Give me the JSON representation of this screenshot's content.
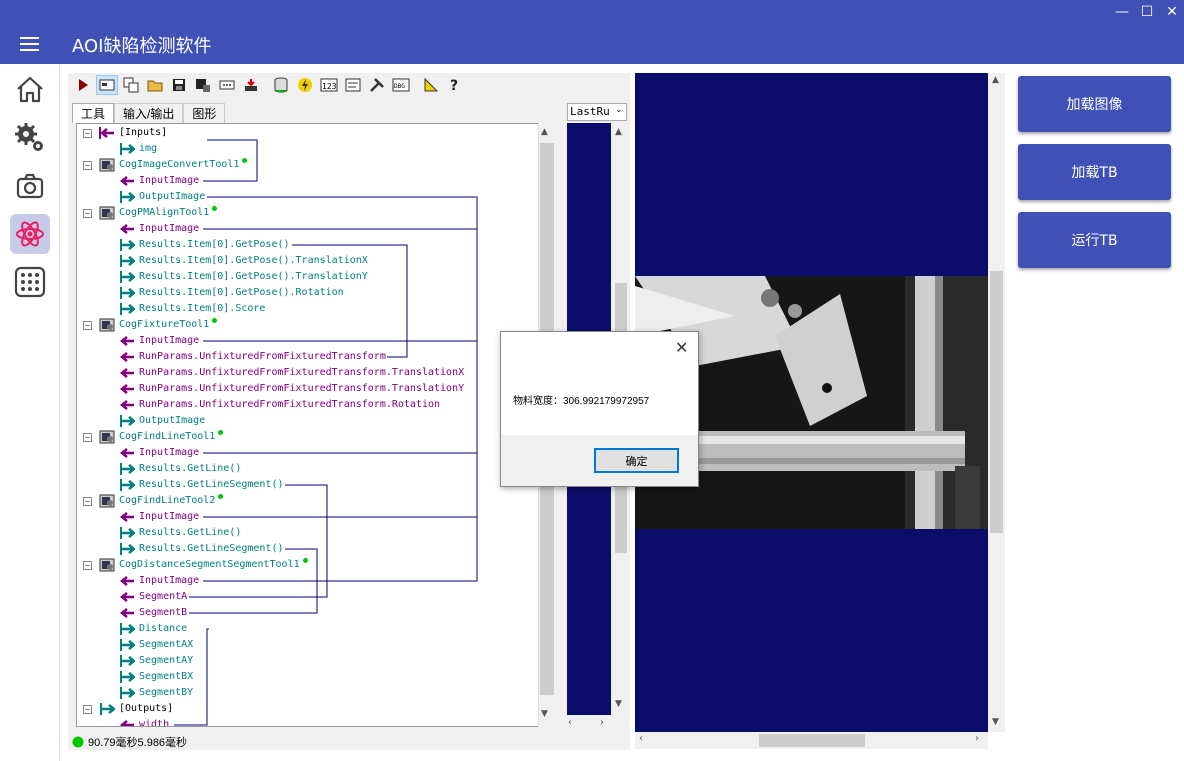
{
  "window": {
    "minimize": "—",
    "maximize": "☐",
    "close": "✕"
  },
  "app": {
    "title": "AOI缺陷检测软件"
  },
  "sidebar": {
    "items": [
      {
        "name": "home-icon"
      },
      {
        "name": "settings-icon"
      },
      {
        "name": "camera-icon"
      },
      {
        "name": "atom-icon",
        "active": true
      },
      {
        "name": "apps-grid-icon"
      }
    ]
  },
  "cog": {
    "tabs": [
      "工具",
      "输入/输出",
      "图形"
    ],
    "lastrun": "LastRu",
    "status": "90.79毫秒5.986毫秒",
    "tree": [
      {
        "text": "[Inputs]",
        "color": "#000000",
        "arrow": "in-root",
        "level": 0
      },
      {
        "text": "img",
        "color": "#008080",
        "arrow": "out",
        "level": 1
      },
      {
        "text": "CogImageConvertTool1",
        "color": "#008080",
        "arrow": "tool",
        "level": 0
      },
      {
        "text": "InputImage",
        "color": "#800080",
        "arrow": "in",
        "level": 1
      },
      {
        "text": "OutputImage",
        "color": "#008080",
        "arrow": "out",
        "level": 1
      },
      {
        "text": "CogPMAlignTool1",
        "color": "#008080",
        "arrow": "tool",
        "level": 0
      },
      {
        "text": "InputImage",
        "color": "#800080",
        "arrow": "in",
        "level": 1
      },
      {
        "text": "Results.Item[0].GetPose()",
        "color": "#008080",
        "arrow": "out",
        "level": 1
      },
      {
        "text": "Results.Item[0].GetPose().TranslationX",
        "color": "#008080",
        "arrow": "out",
        "level": 1
      },
      {
        "text": "Results.Item[0].GetPose().TranslationY",
        "color": "#008080",
        "arrow": "out",
        "level": 1
      },
      {
        "text": "Results.Item[0].GetPose().Rotation",
        "color": "#008080",
        "arrow": "out",
        "level": 1
      },
      {
        "text": "Results.Item[0].Score",
        "color": "#008080",
        "arrow": "out",
        "level": 1
      },
      {
        "text": "CogFixtureTool1",
        "color": "#008080",
        "arrow": "tool",
        "level": 0
      },
      {
        "text": "InputImage",
        "color": "#800080",
        "arrow": "in",
        "level": 1
      },
      {
        "text": "RunParams.UnfixturedFromFixturedTransform",
        "color": "#800080",
        "arrow": "in",
        "level": 1
      },
      {
        "text": "RunParams.UnfixturedFromFixturedTransform.TranslationX",
        "color": "#800080",
        "arrow": "in",
        "level": 1
      },
      {
        "text": "RunParams.UnfixturedFromFixturedTransform.TranslationY",
        "color": "#800080",
        "arrow": "in",
        "level": 1
      },
      {
        "text": "RunParams.UnfixturedFromFixturedTransform.Rotation",
        "color": "#800080",
        "arrow": "in",
        "level": 1
      },
      {
        "text": "OutputImage",
        "color": "#008080",
        "arrow": "out",
        "level": 1
      },
      {
        "text": "CogFindLineTool1",
        "color": "#008080",
        "arrow": "tool",
        "level": 0
      },
      {
        "text": "InputImage",
        "color": "#800080",
        "arrow": "in",
        "level": 1
      },
      {
        "text": "Results.GetLine()",
        "color": "#008080",
        "arrow": "out",
        "level": 1
      },
      {
        "text": "Results.GetLineSegment()",
        "color": "#008080",
        "arrow": "out",
        "level": 1
      },
      {
        "text": "CogFindLineTool2",
        "color": "#008080",
        "arrow": "tool",
        "level": 0
      },
      {
        "text": "InputImage",
        "color": "#800080",
        "arrow": "in",
        "level": 1
      },
      {
        "text": "Results.GetLine()",
        "color": "#008080",
        "arrow": "out",
        "level": 1
      },
      {
        "text": "Results.GetLineSegment()",
        "color": "#008080",
        "arrow": "out",
        "level": 1
      },
      {
        "text": "CogDistanceSegmentSegmentTool1",
        "color": "#008080",
        "arrow": "tool",
        "level": 0
      },
      {
        "text": "InputImage",
        "color": "#800080",
        "arrow": "in",
        "level": 1
      },
      {
        "text": "SegmentA",
        "color": "#800080",
        "arrow": "in",
        "level": 1
      },
      {
        "text": "SegmentB",
        "color": "#800080",
        "arrow": "in",
        "level": 1
      },
      {
        "text": "Distance",
        "color": "#008080",
        "arrow": "out",
        "level": 1
      },
      {
        "text": "SegmentAX",
        "color": "#008080",
        "arrow": "out",
        "level": 1
      },
      {
        "text": "SegmentAY",
        "color": "#008080",
        "arrow": "out",
        "level": 1
      },
      {
        "text": "SegmentBX",
        "color": "#008080",
        "arrow": "out",
        "level": 1
      },
      {
        "text": "SegmentBY",
        "color": "#008080",
        "arrow": "out",
        "level": 1
      },
      {
        "text": "[Outputs]",
        "color": "#000000",
        "arrow": "out-root",
        "level": 0
      },
      {
        "text": "width",
        "color": "#800080",
        "arrow": "in",
        "level": 1
      }
    ]
  },
  "buttons": {
    "load_image": "加载图像",
    "load_tb": "加载TB",
    "run_tb": "运行TB"
  },
  "dialog": {
    "message": "物料宽度：306.992179972957",
    "ok": "确定",
    "close": "✕"
  },
  "colors": {
    "primary": "#3f51b5",
    "display_bg": "#0c0c6b",
    "teal": "#008080",
    "purple": "#800080"
  }
}
